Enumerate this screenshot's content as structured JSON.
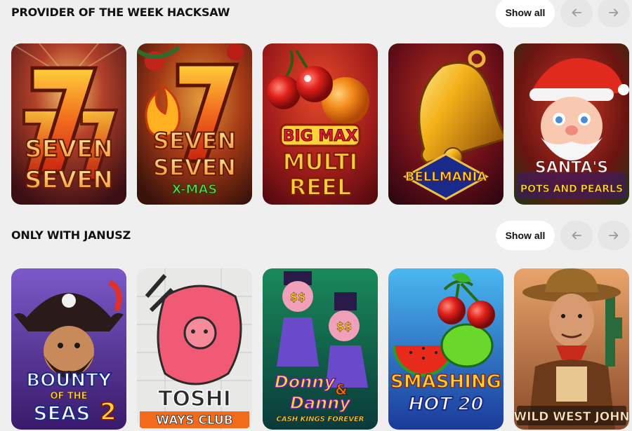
{
  "sections": [
    {
      "title": "PROVIDER OF THE WEEK HACKSAW",
      "show_all": "Show all",
      "prev_icon": "arrow-left-icon",
      "next_icon": "arrow-right-icon",
      "games": [
        {
          "title_lines": [
            "SEVEN",
            "SEVEN"
          ],
          "logo": "seven-seven-logo"
        },
        {
          "title_lines": [
            "SEVEN",
            "SEVEN",
            "X-MAS"
          ],
          "logo": "seven-seven-xmas-logo"
        },
        {
          "title_lines": [
            "BIG MAX",
            "MULTI",
            "REEL"
          ],
          "logo": "big-max-multi-reel-logo"
        },
        {
          "title_lines": [
            "BELLMANIA"
          ],
          "logo": "bellmania-logo"
        },
        {
          "title_lines": [
            "SANTA'S",
            "POTS AND PEARLS"
          ],
          "logo": "santas-pots-and-pearls-logo"
        }
      ]
    },
    {
      "title": "ONLY WITH JANUSZ",
      "show_all": "Show all",
      "prev_icon": "arrow-left-icon",
      "next_icon": "arrow-right-icon",
      "games": [
        {
          "title_lines": [
            "BOUNTY",
            "OF THE",
            "SEAS",
            "2"
          ],
          "logo": "bounty-of-the-seas-2-logo"
        },
        {
          "title_lines": [
            "TOSHI",
            "WAYS CLUB"
          ],
          "logo": "toshi-ways-club-logo"
        },
        {
          "title_lines": [
            "Donny",
            "&",
            "Danny",
            "CASH KINGS FOREVER"
          ],
          "logo": "donny-and-danny-logo"
        },
        {
          "title_lines": [
            "SMASHING",
            "HOT 20"
          ],
          "logo": "smashing-hot-20-logo"
        },
        {
          "title_lines": [
            "WILD WEST JOHN"
          ],
          "logo": "wild-west-john-logo"
        }
      ]
    }
  ]
}
